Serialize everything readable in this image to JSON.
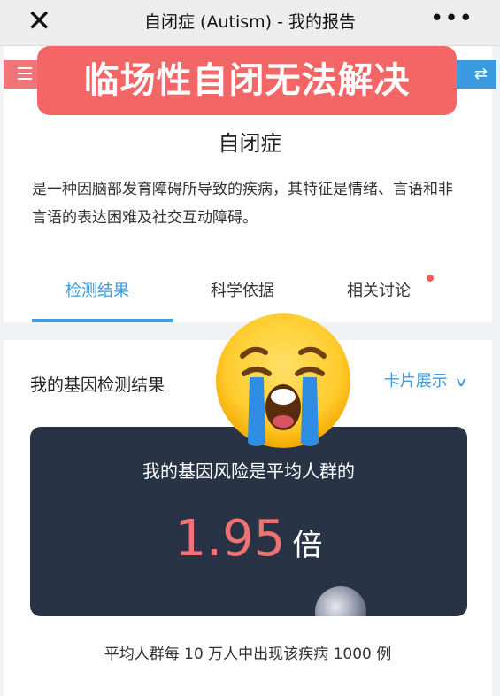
{
  "window": {
    "title": "自闭症 (Autism) - 我的报告",
    "close_glyph": "✕",
    "more_glyph": "•••"
  },
  "banner": {
    "text": "临场性自闭无法解决"
  },
  "disease": {
    "title": "自闭症",
    "description": "是一种因脑部发育障碍所导致的疾病，其特征是情绪、言语和非言语的表达困难及社交互动障碍。"
  },
  "tabs": [
    {
      "label": "检测结果",
      "active": true
    },
    {
      "label": "科学依据",
      "active": false
    },
    {
      "label": "相关讨论",
      "active": false,
      "badge": true
    }
  ],
  "section": {
    "title": "我的基因检测结果",
    "view_toggle": "卡片展示",
    "view_toggle_icon": "chevron-down-icon"
  },
  "risk": {
    "caption": "我的基因风险是平均人群的",
    "value": "1.95",
    "unit": "倍",
    "footnote": "平均人群每 10 万人中出现该疾病 1000 例"
  },
  "colors": {
    "accent": "#3b9be0",
    "banner": "#f46566",
    "card": "#283346",
    "risk_value": "#f07272"
  },
  "icons": [
    "close-icon",
    "more-icon",
    "menu-icon",
    "swap-icon",
    "chevron-down-icon",
    "crying-face-emoji"
  ]
}
